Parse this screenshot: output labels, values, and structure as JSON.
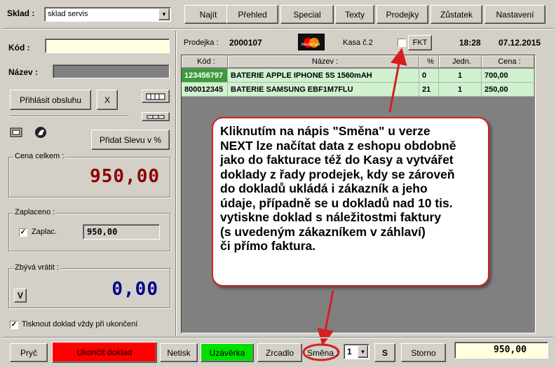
{
  "sklad": {
    "label": "Sklad :",
    "value": "sklad servis"
  },
  "toolbar": [
    "Najít",
    "Přehled",
    "Special",
    "Texty",
    "Prodejky",
    "Zůstatek",
    "Nastavení"
  ],
  "form": {
    "kod_label": "Kód :",
    "kod_value": "",
    "nazev_label": "Název :",
    "nazev_value": "",
    "prihlasit": "Přihlásit obsluhu",
    "close": "X",
    "sleva": "Přidat Slevu v %"
  },
  "header": {
    "prodejka_label": "Prodejka :",
    "prodejka_value": "2000107",
    "card_text": "MasterCard",
    "kasa": "Kasa č.2",
    "fkt": "FKT",
    "time": "18:28",
    "date": "07.12.2015"
  },
  "table": {
    "columns": [
      "Kód :",
      "Název :",
      "%",
      "Jedn.",
      "Cena :"
    ],
    "rows": [
      [
        "123456797",
        "BATERIE APPLE IPHONE 5S 1560mAH",
        "0",
        "1",
        "700,00"
      ],
      [
        "800012345",
        "BATERIE SAMSUNG EBF1M7FLU",
        "21",
        "1",
        "250,00"
      ]
    ]
  },
  "totals": {
    "cena_label": "Cena celkem :",
    "cena_value": "950,00",
    "zaplaceno_label": "Zaplaceno :",
    "zaplac_label": "Zaplac.",
    "zaplac_value": "950,00",
    "zbyva_label": "Zbývá vrátit :",
    "zbyva_value": "0,00",
    "v_button": "V",
    "tisk_label": "Tisknout doklad vždy při ukončení"
  },
  "callout": [
    "Kliknutím na nápis \"Směna\" u verze",
    "NEXT lze načítat data z eshopu obdobně",
    "jako do fakturace též do Kasy a vytvářet",
    "doklady z řady prodejek, kdy se zároveň",
    "do dokladů ukládá i zákazník a jeho",
    "údaje, případně se u dokladů nad 10 tis.",
    "vytiskne doklad s náležitostmi faktury",
    "(s uvedeným zákazníkem v záhlaví)",
    "či přímo faktura."
  ],
  "bottom": {
    "pryc": "Pryč",
    "ukoncit": "Ukončit doklad",
    "netisk": "Netisk",
    "uzaverka": "Uzávěrka",
    "zrcadlo": "Zrcadlo",
    "smena": "Směna :",
    "smena_value": "1",
    "s": "S",
    "storno": "Storno",
    "total": "950,00"
  },
  "colors": {
    "red": "#ff0000",
    "green": "#00e000",
    "row_bg": "#d0f0d0",
    "accent": "#d62020"
  }
}
